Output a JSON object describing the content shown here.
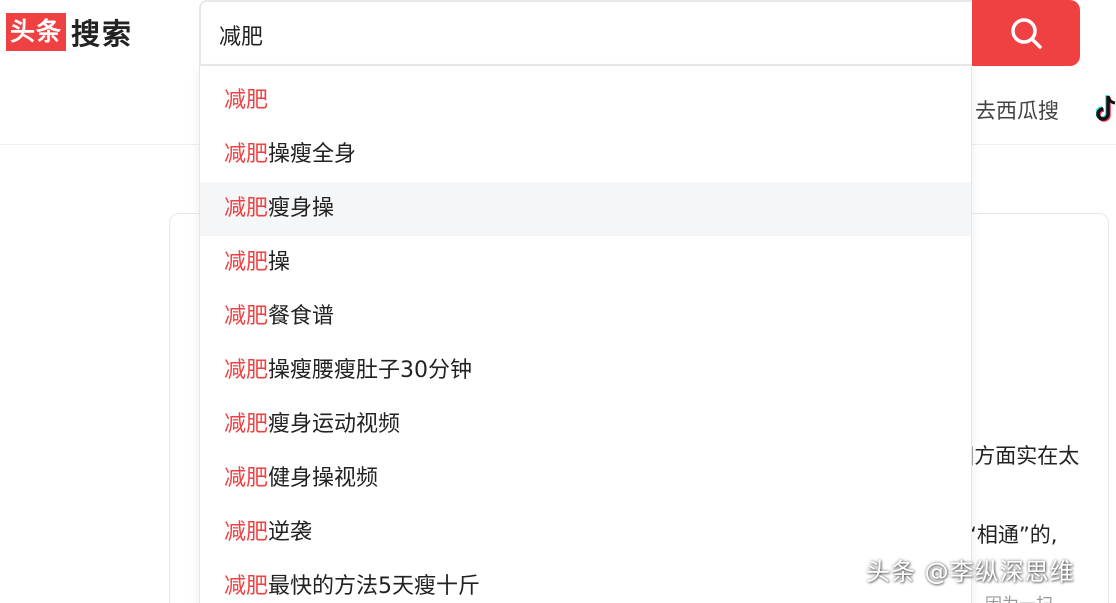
{
  "logo": {
    "badge": "头条",
    "text": "搜索"
  },
  "search": {
    "value": "减肥",
    "button_icon": "search-icon"
  },
  "header": {
    "xigua_link": "去西瓜搜",
    "douyin_icon": "douyin-icon"
  },
  "colors": {
    "brand": "#f04142",
    "highlight": "#f04142",
    "active_row": "#f5f6f8"
  },
  "suggestions": [
    {
      "highlight": "减肥",
      "rest": ""
    },
    {
      "highlight": "减肥",
      "rest": "操瘦全身"
    },
    {
      "highlight": "减肥",
      "rest": "瘦身操"
    },
    {
      "highlight": "减肥",
      "rest": "操"
    },
    {
      "highlight": "减肥",
      "rest": "餐食谱"
    },
    {
      "highlight": "减肥",
      "rest": "操瘦腰瘦肚子30分钟"
    },
    {
      "highlight": "减肥",
      "rest": "瘦身运动视频"
    },
    {
      "highlight": "减肥",
      "rest": "健身操视频"
    },
    {
      "highlight": "减肥",
      "rest": "逆袭"
    },
    {
      "highlight": "减肥",
      "rest": "最快的方法5天瘦十斤"
    }
  ],
  "background_text": {
    "line1": "]方面实在太",
    "line2": "“相通”的,",
    "line3": "，因为一扫"
  },
  "watermark": "头条 @李纵深思维"
}
